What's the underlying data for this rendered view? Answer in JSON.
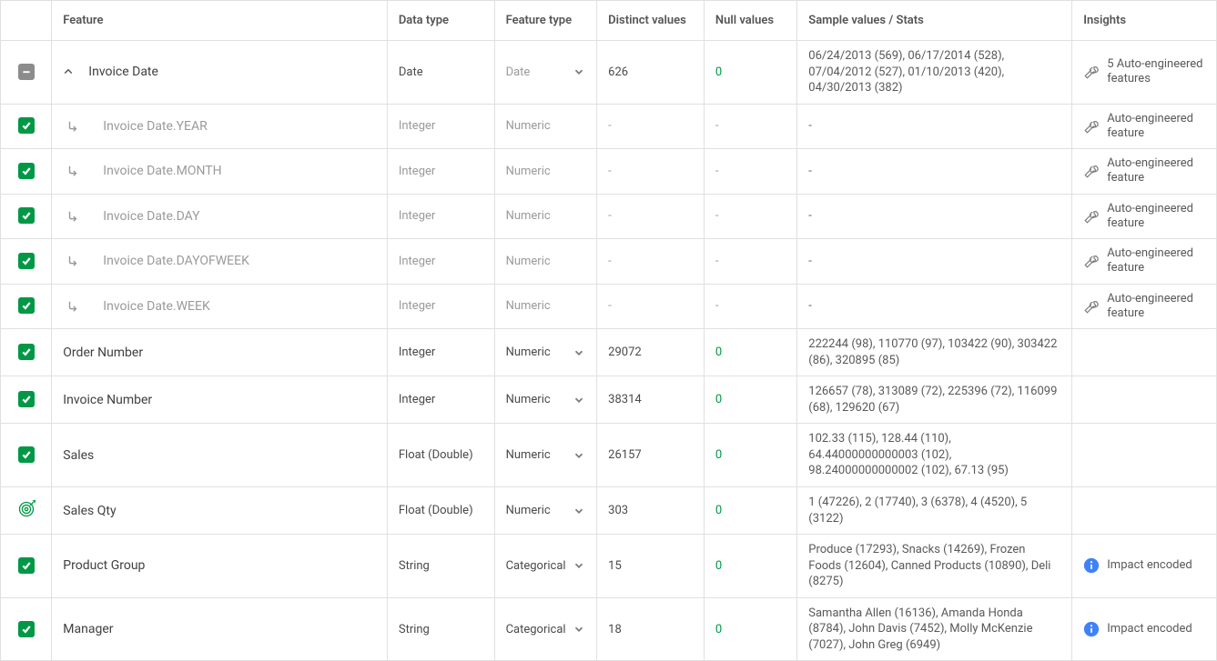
{
  "headers": {
    "feature": "Feature",
    "datatype": "Data type",
    "featuretype": "Feature type",
    "distinct": "Distinct values",
    "nullvals": "Null values",
    "sample": "Sample values / Stats",
    "insights": "Insights"
  },
  "rows": [
    {
      "check": "minus",
      "expand": "up",
      "feature": "Invoice Date",
      "feature_muted": false,
      "child": false,
      "datatype": "Date",
      "ftype": "Date",
      "ftype_muted": true,
      "ftype_dropdown": true,
      "distinct": "626",
      "nullv": "0",
      "sample": "06/24/2013 (569), 06/17/2014 (528), 07/04/2012 (527), 01/10/2013 (420), 04/30/2013 (382)",
      "insight_icon": "wrench",
      "insight": "5 Auto-engineered features"
    },
    {
      "check": "check",
      "feature": "Invoice Date.YEAR",
      "feature_muted": true,
      "child": true,
      "datatype": "Integer",
      "datatype_muted": true,
      "ftype": "Numeric",
      "ftype_muted": true,
      "ftype_dropdown": false,
      "distinct": "-",
      "distinct_muted": true,
      "nullv": "-",
      "nullv_muted": true,
      "sample": "-",
      "sample_muted": true,
      "insight_icon": "wrench",
      "insight": "Auto-engineered feature",
      "insight_muted": true
    },
    {
      "check": "check",
      "feature": "Invoice Date.MONTH",
      "feature_muted": true,
      "child": true,
      "datatype": "Integer",
      "datatype_muted": true,
      "ftype": "Numeric",
      "ftype_muted": true,
      "ftype_dropdown": false,
      "distinct": "-",
      "distinct_muted": true,
      "nullv": "-",
      "nullv_muted": true,
      "sample": "-",
      "sample_muted": true,
      "insight_icon": "wrench",
      "insight": "Auto-engineered feature",
      "insight_muted": true
    },
    {
      "check": "check",
      "feature": "Invoice Date.DAY",
      "feature_muted": true,
      "child": true,
      "datatype": "Integer",
      "datatype_muted": true,
      "ftype": "Numeric",
      "ftype_muted": true,
      "ftype_dropdown": false,
      "distinct": "-",
      "distinct_muted": true,
      "nullv": "-",
      "nullv_muted": true,
      "sample": "-",
      "sample_muted": true,
      "insight_icon": "wrench",
      "insight": "Auto-engineered feature",
      "insight_muted": true
    },
    {
      "check": "check",
      "feature": "Invoice Date.DAYOFWEEK",
      "feature_muted": true,
      "child": true,
      "datatype": "Integer",
      "datatype_muted": true,
      "ftype": "Numeric",
      "ftype_muted": true,
      "ftype_dropdown": false,
      "distinct": "-",
      "distinct_muted": true,
      "nullv": "-",
      "nullv_muted": true,
      "sample": "-",
      "sample_muted": true,
      "insight_icon": "wrench",
      "insight": "Auto-engineered feature",
      "insight_muted": true
    },
    {
      "check": "check",
      "feature": "Invoice Date.WEEK",
      "feature_muted": true,
      "child": true,
      "datatype": "Integer",
      "datatype_muted": true,
      "ftype": "Numeric",
      "ftype_muted": true,
      "ftype_dropdown": false,
      "distinct": "-",
      "distinct_muted": true,
      "nullv": "-",
      "nullv_muted": true,
      "sample": "-",
      "sample_muted": true,
      "insight_icon": "wrench",
      "insight": "Auto-engineered feature",
      "insight_muted": true
    },
    {
      "check": "check",
      "feature": "Order Number",
      "child": false,
      "datatype": "Integer",
      "ftype": "Numeric",
      "ftype_dropdown": true,
      "distinct": "29072",
      "nullv": "0",
      "sample": "222244 (98), 110770 (97), 103422 (90), 303422 (86), 320895 (85)",
      "insight_icon": "",
      "insight": ""
    },
    {
      "check": "check",
      "feature": "Invoice Number",
      "child": false,
      "datatype": "Integer",
      "ftype": "Numeric",
      "ftype_dropdown": true,
      "distinct": "38314",
      "nullv": "0",
      "sample": "126657 (78), 313089 (72), 225396 (72), 116099 (68), 129620 (67)",
      "insight_icon": "",
      "insight": ""
    },
    {
      "check": "check",
      "feature": "Sales",
      "child": false,
      "datatype": "Float (Double)",
      "ftype": "Numeric",
      "ftype_dropdown": true,
      "distinct": "26157",
      "nullv": "0",
      "sample": "102.33 (115), 128.44 (110), 64.44000000000003 (102), 98.24000000000002 (102), 67.13 (95)",
      "insight_icon": "",
      "insight": ""
    },
    {
      "check": "target",
      "feature": "Sales Qty",
      "child": false,
      "datatype": "Float (Double)",
      "ftype": "Numeric",
      "ftype_dropdown": true,
      "distinct": "303",
      "nullv": "0",
      "sample": "1 (47226), 2 (17740), 3 (6378), 4 (4520), 5 (3122)",
      "insight_icon": "",
      "insight": ""
    },
    {
      "check": "check",
      "feature": "Product Group",
      "child": false,
      "datatype": "String",
      "ftype": "Categorical",
      "ftype_dropdown": true,
      "distinct": "15",
      "nullv": "0",
      "sample": "Produce (17293), Snacks (14269), Frozen Foods (12604), Canned Products (10890), Deli (8275)",
      "insight_icon": "info",
      "insight": "Impact encoded"
    },
    {
      "check": "check",
      "feature": "Manager",
      "child": false,
      "datatype": "String",
      "ftype": "Categorical",
      "ftype_dropdown": true,
      "distinct": "18",
      "nullv": "0",
      "sample": "Samantha Allen (16136), Amanda Honda (8784), John Davis (7452), Molly McKenzie (7027), John Greg (6949)",
      "insight_icon": "info",
      "insight": "Impact encoded"
    }
  ]
}
